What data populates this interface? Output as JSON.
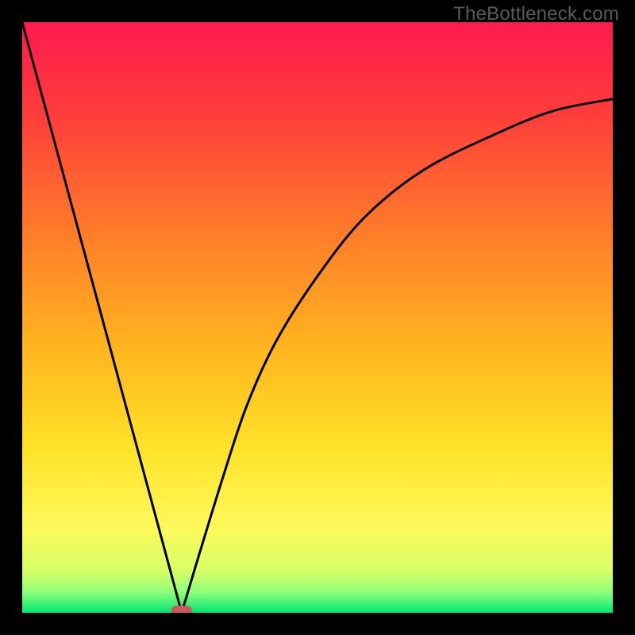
{
  "watermark": "TheBottleneck.com",
  "chart_data": {
    "type": "line",
    "title": "",
    "xlabel": "",
    "ylabel": "",
    "xlim": [
      0,
      1
    ],
    "ylim": [
      0,
      1
    ],
    "gradient_stops": [
      {
        "offset": 0.0,
        "color": "#ff1a4f"
      },
      {
        "offset": 0.15,
        "color": "#ff3b3b"
      },
      {
        "offset": 0.35,
        "color": "#ff7a2a"
      },
      {
        "offset": 0.55,
        "color": "#ffb41f"
      },
      {
        "offset": 0.72,
        "color": "#ffe228"
      },
      {
        "offset": 0.85,
        "color": "#fff85a"
      },
      {
        "offset": 0.93,
        "color": "#d6ff66"
      },
      {
        "offset": 0.965,
        "color": "#8fff7a"
      },
      {
        "offset": 1.0,
        "color": "#00e676"
      }
    ],
    "curve": {
      "description": "V-shaped bottleneck curve. Left branch: straight line from top-left corner down to the minimum. Right branch: concave curve rising from the minimum toward the upper-right, flattening off near y≈0.87 at x=1.",
      "minimum": {
        "x": 0.27,
        "y": 0.0
      },
      "left_branch": [
        {
          "x": 0.0,
          "y": 1.0
        },
        {
          "x": 0.27,
          "y": 0.0
        }
      ],
      "right_branch": [
        {
          "x": 0.27,
          "y": 0.0
        },
        {
          "x": 0.3,
          "y": 0.1
        },
        {
          "x": 0.34,
          "y": 0.23
        },
        {
          "x": 0.38,
          "y": 0.35
        },
        {
          "x": 0.43,
          "y": 0.46
        },
        {
          "x": 0.5,
          "y": 0.57
        },
        {
          "x": 0.58,
          "y": 0.67
        },
        {
          "x": 0.68,
          "y": 0.75
        },
        {
          "x": 0.8,
          "y": 0.81
        },
        {
          "x": 0.9,
          "y": 0.85
        },
        {
          "x": 1.0,
          "y": 0.87
        }
      ]
    },
    "marker": {
      "shape": "rounded-rect",
      "x": 0.27,
      "y": 0.0,
      "color": "#c85a5a"
    }
  }
}
